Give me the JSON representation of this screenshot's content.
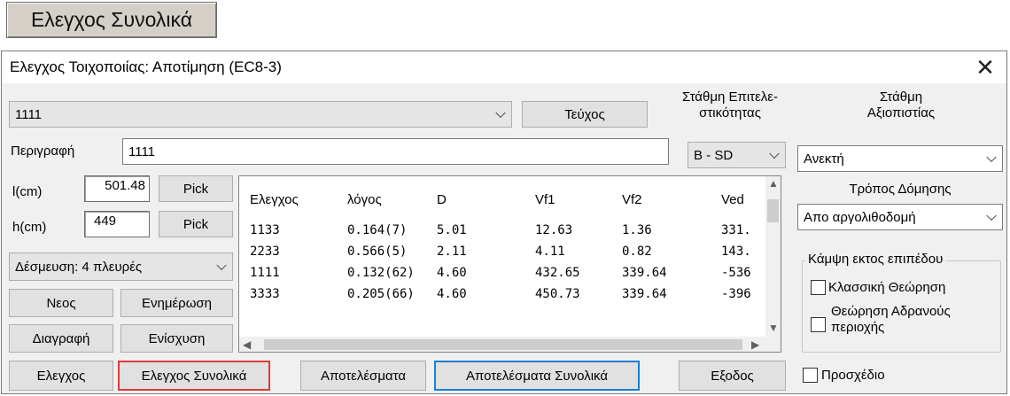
{
  "top_button": {
    "label": "Ελεγχος Συνολικά"
  },
  "dialog": {
    "title": "Ελεγχος Τοιχοποιίας: Αποτίμηση (EC8-3)",
    "close_symbol": "✕",
    "wall_select": {
      "value": "1111"
    },
    "teuxos_button": "Τεύχος",
    "performance_level": {
      "label_line1": "Στάθμη Επιτελε-",
      "label_line2": "στικότητας",
      "value": "B - SD"
    },
    "reliability_level": {
      "label_line1": "Στάθμη",
      "label_line2": "Αξιοπιστίας",
      "value": "Ανεκτή"
    },
    "description": {
      "label": "Περιγραφή",
      "value": "1111"
    },
    "length": {
      "label": "l(cm)",
      "value": "501.48",
      "pick": "Pick"
    },
    "height": {
      "label": "h(cm)",
      "value": "449",
      "pick": "Pick"
    },
    "restraint": {
      "value": "Δέσμευση: 4 πλευρές"
    },
    "buttons": {
      "new": "Νεος",
      "update": "Ενημέρωση",
      "delete": "Διαγραφή",
      "strengthen": "Ενίσχυση",
      "check": "Ελεγχος",
      "check_total": "Ελεγχος Συνολικά",
      "results": "Αποτελέσματα",
      "results_total": "Αποτελέσματα Συνολικά",
      "exit": "Εξοδος"
    },
    "construction": {
      "label": "Τρόπος Δόμησης",
      "value": "Απο αργολιθοδομή"
    },
    "out_of_plane": {
      "title": "Κάμψη εκτος επιπέδου",
      "classic": "Κλασσική Θεώρηση",
      "inert_line1": "Θεώρηση Αδρανούς",
      "inert_line2": "περιοχής"
    },
    "draft": {
      "label": "Προσχέδιο"
    },
    "table": {
      "columns": [
        "Ελεγχος",
        "λόγος",
        "D",
        "Vf1",
        "Vf2",
        "Ved"
      ],
      "rows": [
        [
          "1133",
          "0.164(7)",
          "5.01",
          "12.63",
          "1.36",
          "331."
        ],
        [
          "2233",
          "0.566(5)",
          "2.11",
          "4.11",
          "0.82",
          "143."
        ],
        [
          "1111",
          "0.132(62)",
          "4.60",
          "432.65",
          "339.64",
          "-536"
        ],
        [
          "3333",
          "0.205(66)",
          "4.60",
          "450.73",
          "339.64",
          "-396"
        ]
      ]
    }
  }
}
